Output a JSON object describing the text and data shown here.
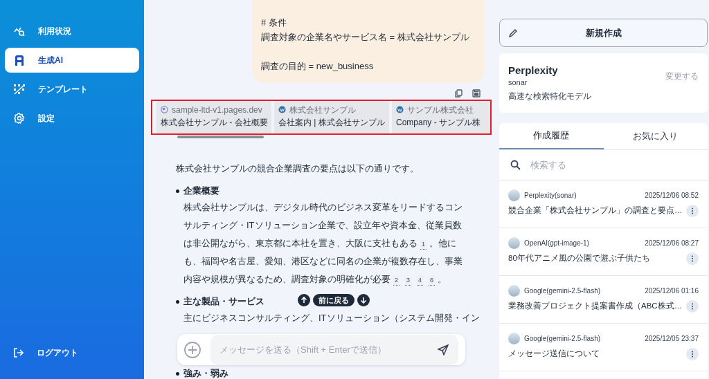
{
  "sidebar": {
    "items": [
      {
        "label": "利用状況",
        "selected": false
      },
      {
        "label": "生成AI",
        "selected": true
      },
      {
        "label": "テンプレート",
        "selected": false
      },
      {
        "label": "設定",
        "selected": false
      }
    ],
    "logout": "ログアウト"
  },
  "chat": {
    "user_message": [
      [
        "# 条件",
        "調査対象の企業名やサービス名 = 株式会社サンプル"
      ],
      [
        "調査の目的 = new_business"
      ]
    ],
    "sources": [
      {
        "site": "sample-ltd-v1.pages.dev",
        "title": "株式会社サンプル - 会社概要",
        "kind": "globe"
      },
      {
        "site": "株式会社サンプル",
        "title": "会社案内 | 株式会社サンプル",
        "kind": "wordpress"
      },
      {
        "site": "サンプル株式会社",
        "title": "Company - サンプル株",
        "kind": "wordpress"
      }
    ],
    "intro": "株式会社サンプルの競合企業調査の要点は以下の通りです。",
    "sections": [
      {
        "heading": "企業概要",
        "body": [
          {
            "text": "株式会社サンプルは、デジタル時代のビジネス変革をリードするコンサルティング・ITソリューション企業で、設立年や資本金、従業員数は非公開ながら、東京都に本社を置き、大阪に支社もある"
          },
          {
            "cite": "1"
          },
          {
            "text": "。他にも、福岡や名古屋、愛知、港区などに同名の企業が複数存在し、事業内容や規模が異なるため、調査対象の明確化が必要"
          },
          {
            "cite": "2"
          },
          {
            "cite": "3"
          },
          {
            "cite": "4"
          },
          {
            "cite": "6"
          },
          {
            "text": "。"
          }
        ]
      },
      {
        "heading": "主な製品・サービス",
        "body": [
          {
            "text": "主にビジネスコンサルティング、ITソリューション（システム開発・イン"
          }
        ]
      }
    ],
    "nav_pill": "前に戻る",
    "input_placeholder": "メッセージを送る（Shift + Enterで送信）",
    "after_heading": "強み・弱み"
  },
  "right": {
    "new_button": "新規作成",
    "model": {
      "name": "Perplexity",
      "variant": "sonar",
      "description": "高速な検索特化モデル",
      "change": "変更する"
    },
    "tabs": [
      {
        "label": "作成履歴",
        "selected": true
      },
      {
        "label": "お気に入り",
        "selected": false
      }
    ],
    "search_placeholder": "検索する",
    "history": [
      {
        "model": "Perplexity(sonar)",
        "date": "2025/12/06 08:52",
        "title": "競合企業「株式会社サンプル」の調査と要点…"
      },
      {
        "model": "OpenAI(gpt-image-1)",
        "date": "2025/12/06 08:27",
        "title": "80年代アニメ風の公園で遊ぶ子供たち"
      },
      {
        "model": "Google(gemini-2.5-flash)",
        "date": "2025/12/06 01:16",
        "title": "業務改善プロジェクト提案書作成（ABC株式…"
      },
      {
        "model": "Google(gemini-2.5-flash)",
        "date": "2025/12/05 23:37",
        "title": "メッセージ送信について"
      }
    ]
  }
}
